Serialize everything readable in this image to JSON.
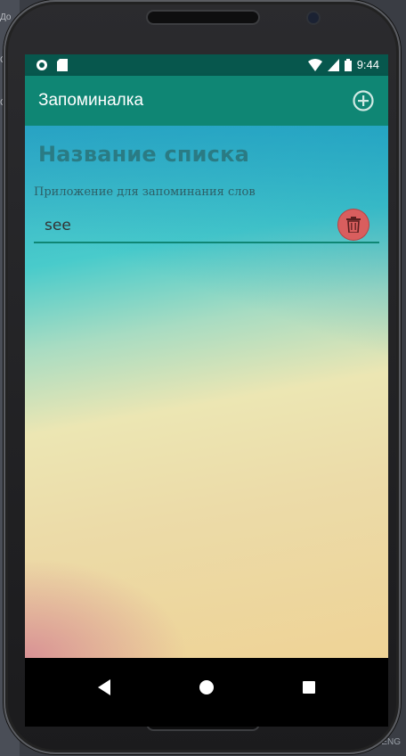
{
  "status_bar": {
    "time": "9:44"
  },
  "app_bar": {
    "title": "Запоминалка",
    "add_icon": "add-circle-icon"
  },
  "list": {
    "title": "Название списка",
    "description": "Приложение для запоминания слов",
    "items": [
      {
        "word": "see",
        "delete_icon": "trash-icon"
      }
    ]
  },
  "colors": {
    "status_bar": "#07574d",
    "app_bar": "#0f8674",
    "accent": "#0f8674",
    "delete_button": "#d95e5e",
    "title_text": "#2a7b84"
  },
  "nav_bar": {
    "back_icon": "back-triangle-icon",
    "home_icon": "home-circle-icon",
    "recents_icon": "recents-square-icon"
  },
  "desktop": {
    "left_fragments": [
      "До",
      "С",
      "С"
    ],
    "right_fragment": "ENG"
  }
}
